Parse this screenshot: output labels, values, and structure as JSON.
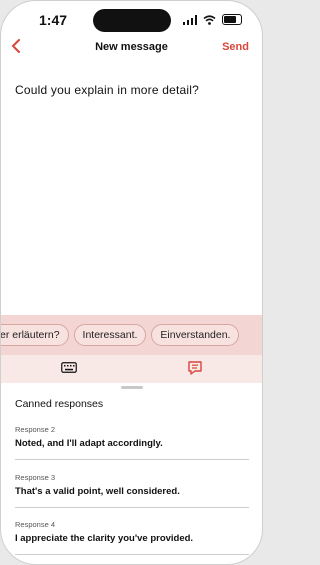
{
  "status_bar": {
    "time": "1:47"
  },
  "nav": {
    "title": "New message",
    "send_label": "Send"
  },
  "message": {
    "text": "Could you explain in more detail?"
  },
  "suggestions": [
    "er erläutern?",
    "Interessant.",
    "Einverstanden."
  ],
  "icons": {
    "back": "chevron-left-icon",
    "keyboard": "keyboard-icon",
    "message": "message-icon"
  },
  "colors": {
    "accent": "#d9463b",
    "strip": "#f3d6d3"
  },
  "canned": {
    "title": "Canned responses",
    "items": [
      {
        "label": "Response 2",
        "text": "Noted, and I'll adapt accordingly."
      },
      {
        "label": "Response 3",
        "text": "That's a valid point, well considered."
      },
      {
        "label": "Response 4",
        "text": "I appreciate the clarity you've provided."
      }
    ]
  }
}
